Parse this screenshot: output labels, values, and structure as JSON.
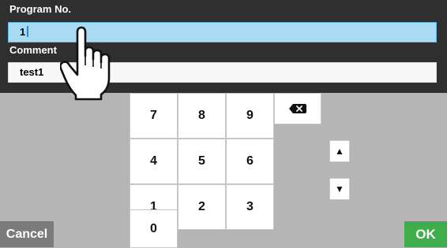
{
  "form": {
    "program_label": "Program No.",
    "program_value": "1",
    "comment_label": "Comment",
    "comment_value": "test1"
  },
  "keypad": {
    "keys": [
      "7",
      "8",
      "9",
      "4",
      "5",
      "6",
      "1",
      "2",
      "3",
      "0"
    ],
    "up_symbol": "▲",
    "down_symbol": "▼",
    "backspace_icon": "backspace-icon"
  },
  "actions": {
    "cancel_label": "Cancel",
    "ok_label": "OK"
  },
  "colors": {
    "active_field": "#a8daf3",
    "ok_button": "#3fae4a",
    "cancel_button": "#7b7b7b",
    "panel": "#2f2f2f",
    "background": "#b5b5b5"
  }
}
